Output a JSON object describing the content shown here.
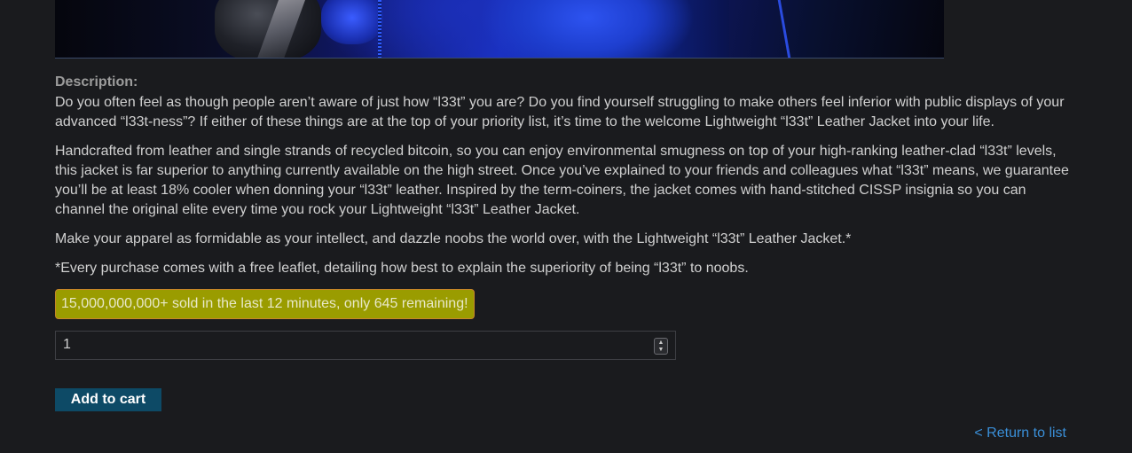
{
  "product": {
    "image_alt": "Lightweight l33t Leather Jacket product photo"
  },
  "description": {
    "label": "Description:",
    "paragraphs": [
      "Do you often feel as though people aren’t aware of just how “l33t” you are? Do you find yourself struggling to make others feel inferior with public displays of your advanced “l33t-ness”? If either of these things are at the top of your priority list, it’s time to the welcome Lightweight “l33t” Leather Jacket into your life.",
      "Handcrafted from leather and single strands of recycled bitcoin, so you can enjoy environmental smugness on top of your high-ranking leather-clad “l33t” levels, this jacket is far superior to anything currently available on the high street. Once you’ve explained to your friends and colleagues what “l33t” means, we guarantee you’ll be at least 18% cooler when donning your “l33t” leather. Inspired by the term-coiners, the jacket comes with hand-stitched CISSP insignia so you can channel the original elite every time you rock your Lightweight “l33t” Leather Jacket.",
      "Make your apparel as formidable as your intellect, and dazzle noobs the world over, with the Lightweight “l33t” Leather Jacket.*",
      "*Every purchase comes with a free leaflet, detailing how best to explain the superiority of being “l33t” to noobs."
    ]
  },
  "stock": {
    "text": "15,000,000,000+ sold in the last 12 minutes, only 645 remaining!"
  },
  "quantity": {
    "value": "1"
  },
  "actions": {
    "add_to_cart": "Add to cart",
    "return_to_list": "< Return to list"
  }
}
